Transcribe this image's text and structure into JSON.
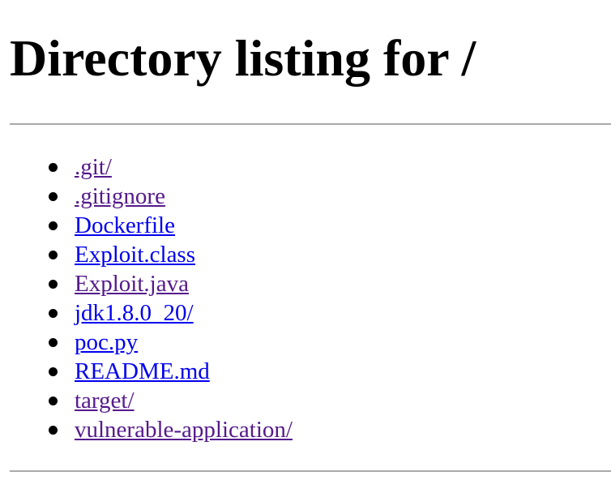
{
  "page": {
    "title": "Directory listing for /"
  },
  "colors": {
    "link_unvisited": "#0000ee",
    "link_visited": "#551a8b",
    "divider": "#a9a9a9"
  },
  "files": [
    {
      "name": ".git/",
      "visited": true
    },
    {
      "name": ".gitignore",
      "visited": true
    },
    {
      "name": "Dockerfile",
      "visited": false
    },
    {
      "name": "Exploit.class",
      "visited": false
    },
    {
      "name": "Exploit.java",
      "visited": true
    },
    {
      "name": "jdk1.8.0_20/",
      "visited": false
    },
    {
      "name": "poc.py",
      "visited": false
    },
    {
      "name": "README.md",
      "visited": false
    },
    {
      "name": "target/",
      "visited": true
    },
    {
      "name": "vulnerable-application/",
      "visited": true
    }
  ]
}
